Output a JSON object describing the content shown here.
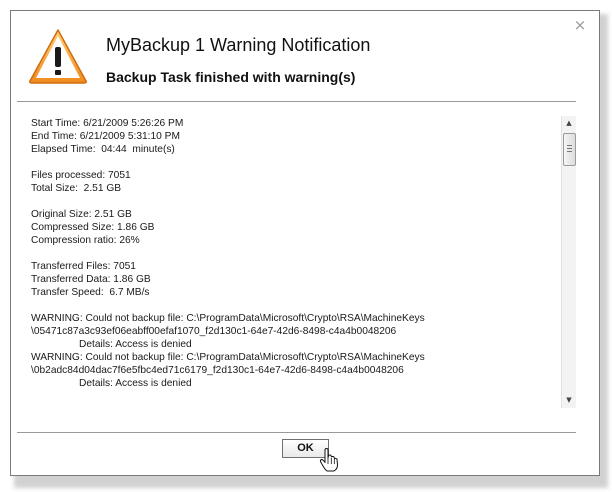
{
  "dialog": {
    "title": "MyBackup 1 Warning Notification",
    "subtitle": "Backup Task finished with warning(s)",
    "close_glyph": "×",
    "ok_label": "OK"
  },
  "icons": {
    "header": "warning-triangle-icon",
    "close": "close-icon",
    "cursor": "hand-pointer-icon"
  },
  "colors": {
    "warning_orange": "#f08a1c",
    "warning_light": "#ffd27a"
  },
  "log": {
    "lines": [
      "Start Time: 6/21/2009 5:26:26 PM",
      "End Time: 6/21/2009 5:31:10 PM",
      "Elapsed Time:  04:44  minute(s)",
      "",
      "Files processed: 7051",
      "Total Size:  2.51 GB",
      "",
      "Original Size: 2.51 GB",
      "Compressed Size: 1.86 GB",
      "Compression ratio: 26%",
      "",
      "Transferred Files: 7051",
      "Transferred Data: 1.86 GB",
      "Transfer Speed:  6.7 MB/s",
      "",
      "WARNING: Could not backup file: C:\\ProgramData\\Microsoft\\Crypto\\RSA\\MachineKeys",
      "\\05471c87a3c93ef06eabff00efaf1070_f2d130c1-64e7-42d6-8498-c4a4b0048206",
      ">Details: Access is denied",
      "WARNING: Could not backup file: C:\\ProgramData\\Microsoft\\Crypto\\RSA\\MachineKeys",
      "\\0b2adc84d04dac7f6e5fbc4ed71c6179_f2d130c1-64e7-42d6-8498-c4a4b0048206",
      ">Details: Access is denied"
    ]
  }
}
